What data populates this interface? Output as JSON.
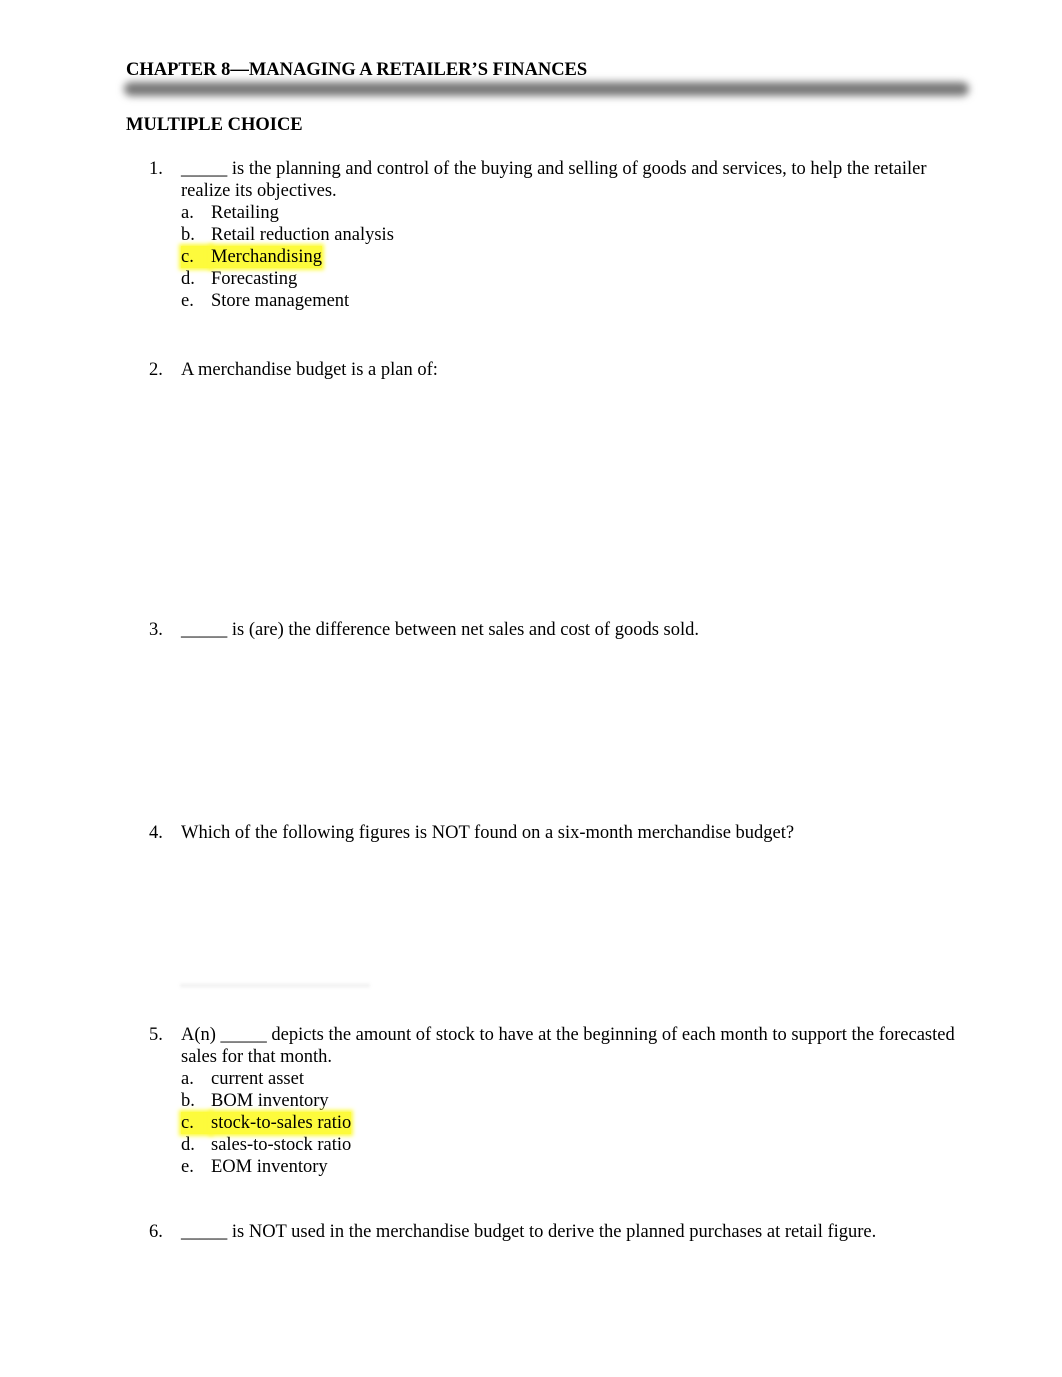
{
  "header": {
    "title": "CHAPTER 8—MANAGING A RETAILER’S FINANCES",
    "section": "MULTIPLE CHOICE"
  },
  "highlight_color": "#fdfb3c",
  "questions": [
    {
      "number": "1.",
      "stem": "_____ is the planning and control of the buying and selling of goods and services, to help the retailer realize its objectives.",
      "options": [
        {
          "letter": "a.",
          "text": "Retailing"
        },
        {
          "letter": "b.",
          "text": "Retail reduction analysis"
        },
        {
          "letter": "c.",
          "text": "Merchandising",
          "highlighted": true
        },
        {
          "letter": "d.",
          "text": "Forecasting"
        },
        {
          "letter": "e.",
          "text": "Store management"
        }
      ]
    },
    {
      "number": "2.",
      "stem": "A merchandise budget is a plan of:",
      "options": []
    },
    {
      "number": "3.",
      "stem": "_____ is (are) the difference between net sales and cost of goods sold.",
      "options": []
    },
    {
      "number": "4.",
      "stem": "Which of the following figures is NOT found on a six-month merchandise budget?",
      "options": []
    },
    {
      "number": "5.",
      "stem": "A(n) _____ depicts the amount of stock to have at the beginning of each month to support the forecasted sales for that month.",
      "options": [
        {
          "letter": "a.",
          "text": "current asset"
        },
        {
          "letter": "b.",
          "text": "BOM inventory"
        },
        {
          "letter": "c.",
          "text": "stock-to-sales ratio",
          "highlighted": true
        },
        {
          "letter": "d.",
          "text": "sales-to-stock ratio"
        },
        {
          "letter": "e.",
          "text": "EOM inventory"
        }
      ]
    },
    {
      "number": "6.",
      "stem": "_____ is NOT used in the merchandise budget to derive the planned purchases at retail figure.",
      "options": []
    }
  ]
}
